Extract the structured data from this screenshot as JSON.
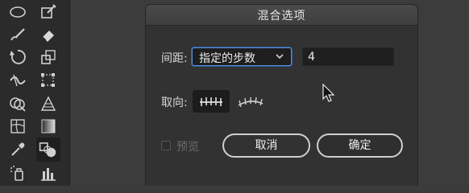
{
  "dialog": {
    "title": "混合选项",
    "spacing": {
      "label": "间距:",
      "selected_option": "指定的步数",
      "steps_value": "4"
    },
    "orientation": {
      "label": "取向:",
      "options": [
        "align-to-page",
        "align-to-path"
      ],
      "selected": "align-to-page"
    },
    "preview": {
      "label": "预览",
      "checked": false,
      "enabled": false
    },
    "buttons": {
      "cancel": "取消",
      "ok": "确定"
    }
  },
  "toolbar": {
    "tools": [
      "ellipse-icon",
      "shaper-icon",
      "paintbrush-icon",
      "eraser-icon",
      "rotate-icon",
      "scale-icon",
      "width-icon",
      "free-transform-icon",
      "shape-builder-icon",
      "perspective-grid-icon",
      "mesh-icon",
      "gradient-icon",
      "eyedropper-icon",
      "blend-icon",
      "symbol-sprayer-icon",
      "column-graph-icon"
    ],
    "selected": "blend-icon"
  }
}
